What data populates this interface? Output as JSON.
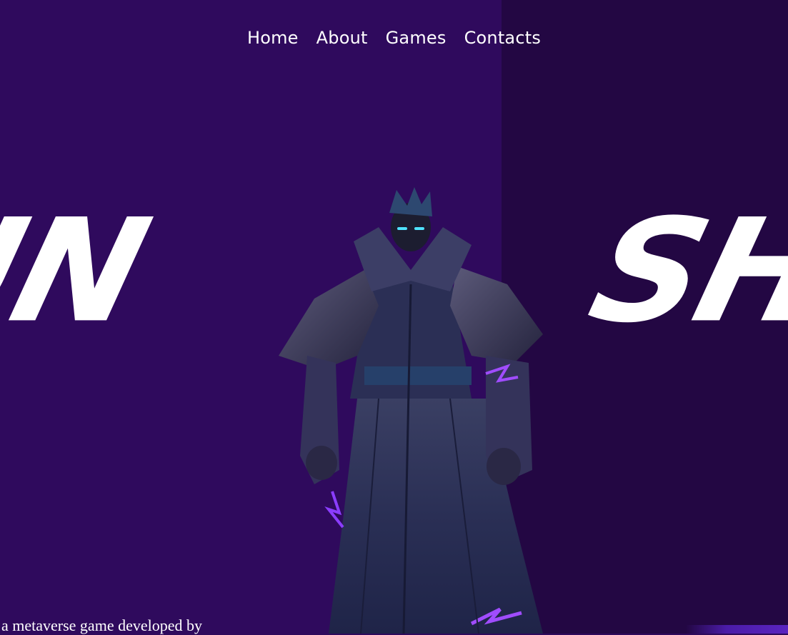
{
  "nav": {
    "items": [
      "Home",
      "About",
      "Games",
      "Contacts"
    ]
  },
  "hero": {
    "title_left_fragment": "UN",
    "title_right_fragment": "SH",
    "tagline": "a metaverse game developed by"
  },
  "colors": {
    "background_left": "#2f0a5d",
    "background_right": "#230743",
    "text": "#ffffff",
    "accent": "#7c3aed"
  },
  "icons": {
    "hero_figure": "dark-caped-warrior-illustration"
  }
}
